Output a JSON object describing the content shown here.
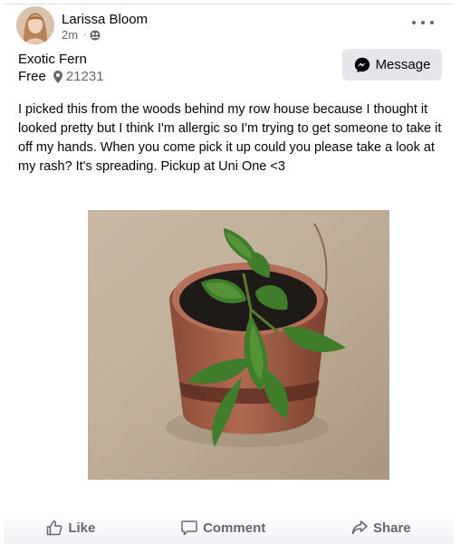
{
  "post": {
    "author": "Larissa Bloom",
    "time": "2m",
    "separator": "·",
    "audience_icon": "friends-icon"
  },
  "listing": {
    "title": "Exotic Fern",
    "price": "Free",
    "location_icon": "map-pin-icon",
    "zip": "21231"
  },
  "message_button": {
    "label": "Message",
    "icon": "messenger-icon"
  },
  "body": "I picked this from the woods behind my row house because I thought it looked pretty but I think I'm allergic so I'm trying to get someone to take it off my hands. When you come pick it up could you please take a look at my rash? It's spreading. Pickup at Uni One <3",
  "actions": {
    "like": "Like",
    "comment": "Comment",
    "share": "Share"
  },
  "colors": {
    "secondary_text": "#65676b",
    "button_bg": "#e4e6eb",
    "primary_text": "#050505"
  }
}
